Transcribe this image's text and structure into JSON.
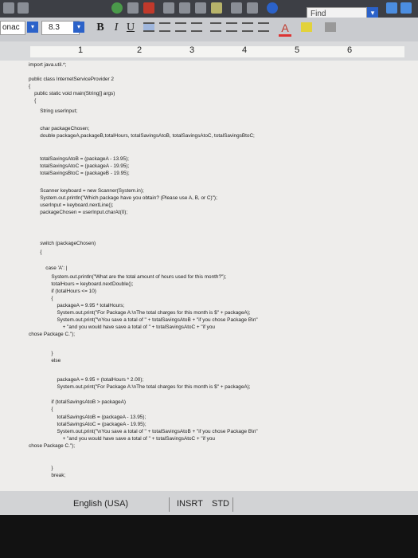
{
  "toolbar": {
    "find_placeholder": "Find",
    "font_name": "onac",
    "font_size": "8.3",
    "bold": "B",
    "italic": "I",
    "underline": "U",
    "highlight": "A"
  },
  "ruler": {
    "numbers": [
      "1",
      "2",
      "3",
      "4",
      "5",
      "6"
    ]
  },
  "document": {
    "lines": [
      "import java.util.*;",
      "public class InternetServiceProvider 2",
      "{",
      "    public static void main(String[] args)",
      "    {",
      "        String userInput;",
      "",
      "        char packageChosen;",
      "        double packageA,packageB,totalHours, totalSavingsAtoB, totalSavingsAtoC, totalSavingsBtoC;",
      "",
      "        totalSavingsAtoB = (packageA - 13.95);",
      "        totalSavingsAtoC = (packageA - 19.95);",
      "        totalSavingsBtoC = (packageB - 19.95);",
      "",
      "        Scanner keyboard = new Scanner(System.in);",
      "        System.out.println(\"Which package have you obtain? (Please use A, B, or C)\");",
      "        userInput = keyboard.nextLine();",
      "        packageChosen = userInput.charAt(0);",
      "",
      "",
      "        switch (packageChosen)",
      "        {",
      "            case 'A': |",
      "                System.out.println(\"What are the total amount of hours used for this month?\");",
      "                totalHours = keyboard.nextDouble();",
      "                if (totalHours <= 10)",
      "                {",
      "                    packageA = 9.95 * totalHours;",
      "                    System.out.print(\"For Package A:\\nThe total charges for this month is $\" + packageA);",
      "                    System.out.print(\"\\nYou save a total of \" + totalSavingsAtoB + \"if you chose Package B\\n\"",
      "                        + \"and you would have save a total of \" + totalSavingsAtoC + \"if you",
      "chose Package C.\");",
      "                }",
      "                else",
      "",
      "                    packageA = 9.95 + (totalHours * 2.00);",
      "                    System.out.print(\"For Package A:\\nThe total charges for this month is $\" + packageA);",
      "",
      "                if (totalSavingsAtoB > packageA)",
      "                {",
      "                    totalSavingsAtoB = (packageA - 13.95);",
      "                    totalSavingsAtoC = (packageA - 19.95);",
      "                    System.out.print(\"\\nYou save a total of \" + totalSavingsAtoB + \"if you chose Package B\\n\"",
      "                        + \"and you would have save a total of \" + totalSavingsAtoC + \"if you",
      "chose Package C.\");",
      "",
      "                }",
      "                break;"
    ]
  },
  "status": {
    "language": "English (USA)",
    "insert_mode": "INSRT",
    "standard": "STD"
  }
}
